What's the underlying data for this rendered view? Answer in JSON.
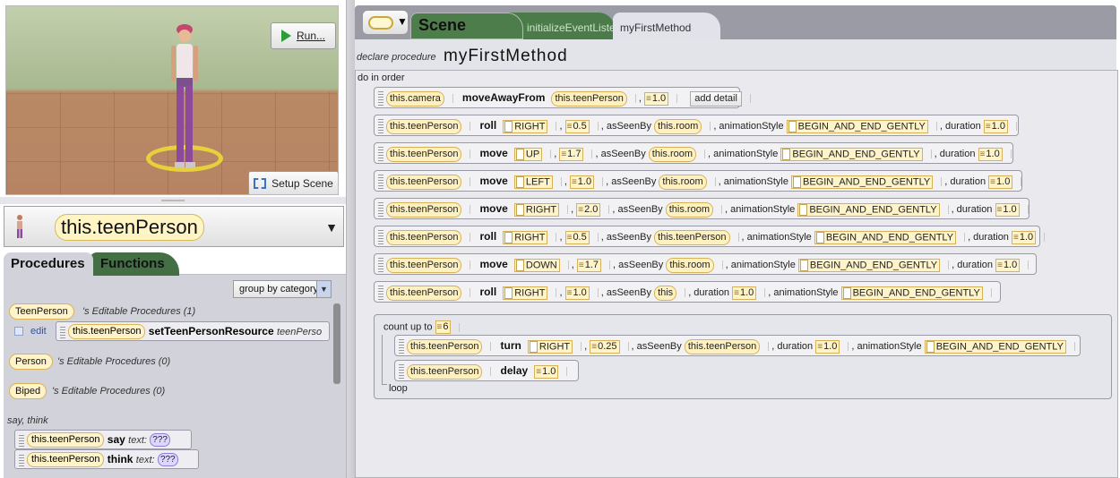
{
  "scene": {
    "run_label": "Run...",
    "setup_label": "Setup Scene"
  },
  "selector": {
    "value": "this.teenPerson"
  },
  "left_tabs": {
    "procedures": "Procedures",
    "functions": "Functions"
  },
  "group_by": "group by category",
  "classes": [
    {
      "name": "TeenPerson",
      "label": "'s Editable Procedures (1)"
    },
    {
      "name": "Person",
      "label": "'s Editable Procedures (0)"
    },
    {
      "name": "Biped",
      "label": "'s Editable Procedures (0)"
    }
  ],
  "edit_row": {
    "edit_label": "edit",
    "target": "this.teenPerson",
    "method": "setTeenPersonResource",
    "param": "teenPerso"
  },
  "say_think": {
    "header": "say, think",
    "items": [
      {
        "target": "this.teenPerson",
        "method": "say",
        "param": "text:",
        "value": "???"
      },
      {
        "target": "this.teenPerson",
        "method": "think",
        "param": "text:",
        "value": "???"
      }
    ]
  },
  "editor_tabs": {
    "scene": "Scene",
    "init": "initializeEventListeners",
    "method": "myFirstMethod"
  },
  "declaration": {
    "prefix": "declare procedure",
    "name": "myFirstMethod"
  },
  "do_in_order": "do in order",
  "statements": [
    {
      "target": "this.camera",
      "method": "moveAwayFrom",
      "args": "this.teenPerson",
      "num": "1.0",
      "extra": "add detail"
    },
    {
      "target": "this.teenPerson",
      "method": "roll",
      "dir": "RIGHT",
      "num": "0.5",
      "asSeenBy": "this.room",
      "style": "BEGIN_AND_END_GENTLY",
      "duration": "1.0"
    },
    {
      "target": "this.teenPerson",
      "method": "move",
      "dir": "UP",
      "num": "1.7",
      "asSeenBy": "this.room",
      "style": "BEGIN_AND_END_GENTLY",
      "duration": "1.0"
    },
    {
      "target": "this.teenPerson",
      "method": "move",
      "dir": "LEFT",
      "num": "1.0",
      "asSeenBy": "this.room",
      "style": "BEGIN_AND_END_GENTLY",
      "duration": "1.0"
    },
    {
      "target": "this.teenPerson",
      "method": "move",
      "dir": "RIGHT",
      "num": "2.0",
      "asSeenBy": "this.room",
      "style": "BEGIN_AND_END_GENTLY",
      "duration": "1.0"
    },
    {
      "target": "this.teenPerson",
      "method": "roll",
      "dir": "RIGHT",
      "num": "0.5",
      "asSeenBy": "this.teenPerson",
      "style": "BEGIN_AND_END_GENTLY",
      "duration": "1.0"
    },
    {
      "target": "this.teenPerson",
      "method": "move",
      "dir": "DOWN",
      "num": "1.7",
      "asSeenBy": "this.room",
      "style": "BEGIN_AND_END_GENTLY",
      "duration": "1.0"
    },
    {
      "target": "this.teenPerson",
      "method": "roll",
      "dir": "RIGHT",
      "num": "1.0",
      "asSeenBy": "this",
      "duration": "1.0",
      "style": "BEGIN_AND_END_GENTLY"
    }
  ],
  "loop": {
    "count_label": "count up to",
    "count": "6",
    "loop_label": "loop",
    "turn": {
      "target": "this.teenPerson",
      "method": "turn",
      "dir": "RIGHT",
      "num": "0.25",
      "asSeenBy": "this.teenPerson",
      "duration": "1.0",
      "style": "BEGIN_AND_END_GENTLY"
    },
    "delay": {
      "target": "this.teenPerson",
      "method": "delay",
      "num": "1.0"
    }
  },
  "labels": {
    "asSeenBy": ", asSeenBy",
    "animationStyle": ", animationStyle",
    "duration": ", duration",
    "comma": ","
  }
}
